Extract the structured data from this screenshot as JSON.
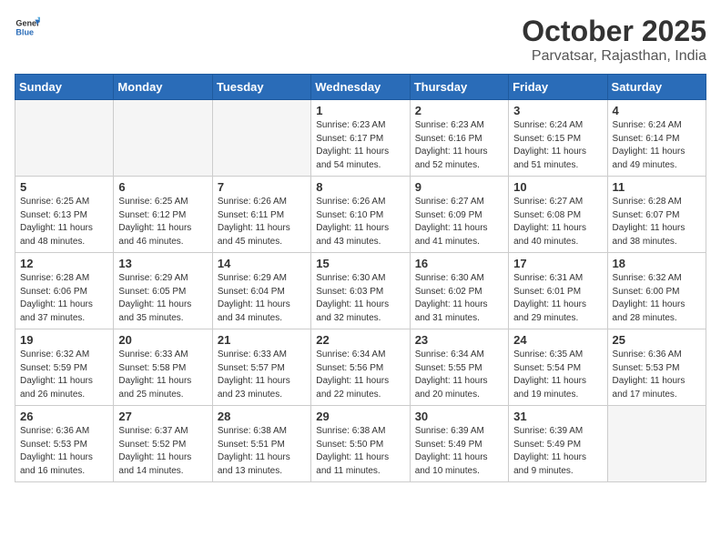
{
  "header": {
    "logo_general": "General",
    "logo_blue": "Blue",
    "title": "October 2025",
    "subtitle": "Parvatsar, Rajasthan, India"
  },
  "weekdays": [
    "Sunday",
    "Monday",
    "Tuesday",
    "Wednesday",
    "Thursday",
    "Friday",
    "Saturday"
  ],
  "weeks": [
    [
      {
        "day": "",
        "info": ""
      },
      {
        "day": "",
        "info": ""
      },
      {
        "day": "",
        "info": ""
      },
      {
        "day": "1",
        "info": "Sunrise: 6:23 AM\nSunset: 6:17 PM\nDaylight: 11 hours\nand 54 minutes."
      },
      {
        "day": "2",
        "info": "Sunrise: 6:23 AM\nSunset: 6:16 PM\nDaylight: 11 hours\nand 52 minutes."
      },
      {
        "day": "3",
        "info": "Sunrise: 6:24 AM\nSunset: 6:15 PM\nDaylight: 11 hours\nand 51 minutes."
      },
      {
        "day": "4",
        "info": "Sunrise: 6:24 AM\nSunset: 6:14 PM\nDaylight: 11 hours\nand 49 minutes."
      }
    ],
    [
      {
        "day": "5",
        "info": "Sunrise: 6:25 AM\nSunset: 6:13 PM\nDaylight: 11 hours\nand 48 minutes."
      },
      {
        "day": "6",
        "info": "Sunrise: 6:25 AM\nSunset: 6:12 PM\nDaylight: 11 hours\nand 46 minutes."
      },
      {
        "day": "7",
        "info": "Sunrise: 6:26 AM\nSunset: 6:11 PM\nDaylight: 11 hours\nand 45 minutes."
      },
      {
        "day": "8",
        "info": "Sunrise: 6:26 AM\nSunset: 6:10 PM\nDaylight: 11 hours\nand 43 minutes."
      },
      {
        "day": "9",
        "info": "Sunrise: 6:27 AM\nSunset: 6:09 PM\nDaylight: 11 hours\nand 41 minutes."
      },
      {
        "day": "10",
        "info": "Sunrise: 6:27 AM\nSunset: 6:08 PM\nDaylight: 11 hours\nand 40 minutes."
      },
      {
        "day": "11",
        "info": "Sunrise: 6:28 AM\nSunset: 6:07 PM\nDaylight: 11 hours\nand 38 minutes."
      }
    ],
    [
      {
        "day": "12",
        "info": "Sunrise: 6:28 AM\nSunset: 6:06 PM\nDaylight: 11 hours\nand 37 minutes."
      },
      {
        "day": "13",
        "info": "Sunrise: 6:29 AM\nSunset: 6:05 PM\nDaylight: 11 hours\nand 35 minutes."
      },
      {
        "day": "14",
        "info": "Sunrise: 6:29 AM\nSunset: 6:04 PM\nDaylight: 11 hours\nand 34 minutes."
      },
      {
        "day": "15",
        "info": "Sunrise: 6:30 AM\nSunset: 6:03 PM\nDaylight: 11 hours\nand 32 minutes."
      },
      {
        "day": "16",
        "info": "Sunrise: 6:30 AM\nSunset: 6:02 PM\nDaylight: 11 hours\nand 31 minutes."
      },
      {
        "day": "17",
        "info": "Sunrise: 6:31 AM\nSunset: 6:01 PM\nDaylight: 11 hours\nand 29 minutes."
      },
      {
        "day": "18",
        "info": "Sunrise: 6:32 AM\nSunset: 6:00 PM\nDaylight: 11 hours\nand 28 minutes."
      }
    ],
    [
      {
        "day": "19",
        "info": "Sunrise: 6:32 AM\nSunset: 5:59 PM\nDaylight: 11 hours\nand 26 minutes."
      },
      {
        "day": "20",
        "info": "Sunrise: 6:33 AM\nSunset: 5:58 PM\nDaylight: 11 hours\nand 25 minutes."
      },
      {
        "day": "21",
        "info": "Sunrise: 6:33 AM\nSunset: 5:57 PM\nDaylight: 11 hours\nand 23 minutes."
      },
      {
        "day": "22",
        "info": "Sunrise: 6:34 AM\nSunset: 5:56 PM\nDaylight: 11 hours\nand 22 minutes."
      },
      {
        "day": "23",
        "info": "Sunrise: 6:34 AM\nSunset: 5:55 PM\nDaylight: 11 hours\nand 20 minutes."
      },
      {
        "day": "24",
        "info": "Sunrise: 6:35 AM\nSunset: 5:54 PM\nDaylight: 11 hours\nand 19 minutes."
      },
      {
        "day": "25",
        "info": "Sunrise: 6:36 AM\nSunset: 5:53 PM\nDaylight: 11 hours\nand 17 minutes."
      }
    ],
    [
      {
        "day": "26",
        "info": "Sunrise: 6:36 AM\nSunset: 5:53 PM\nDaylight: 11 hours\nand 16 minutes."
      },
      {
        "day": "27",
        "info": "Sunrise: 6:37 AM\nSunset: 5:52 PM\nDaylight: 11 hours\nand 14 minutes."
      },
      {
        "day": "28",
        "info": "Sunrise: 6:38 AM\nSunset: 5:51 PM\nDaylight: 11 hours\nand 13 minutes."
      },
      {
        "day": "29",
        "info": "Sunrise: 6:38 AM\nSunset: 5:50 PM\nDaylight: 11 hours\nand 11 minutes."
      },
      {
        "day": "30",
        "info": "Sunrise: 6:39 AM\nSunset: 5:49 PM\nDaylight: 11 hours\nand 10 minutes."
      },
      {
        "day": "31",
        "info": "Sunrise: 6:39 AM\nSunset: 5:49 PM\nDaylight: 11 hours\nand 9 minutes."
      },
      {
        "day": "",
        "info": ""
      }
    ]
  ]
}
